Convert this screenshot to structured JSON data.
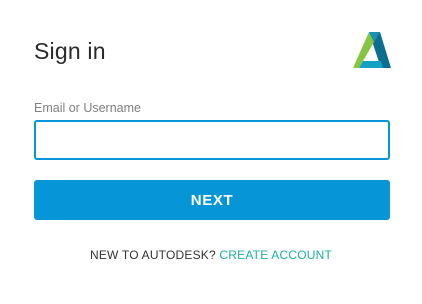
{
  "header": {
    "title": "Sign in",
    "logo_icon": "autodesk-logo-icon"
  },
  "form": {
    "email_label": "Email or Username",
    "email_value": "",
    "email_placeholder": "",
    "next_label": "NEXT"
  },
  "signup": {
    "prompt": "NEW TO AUTODESK?",
    "link_label": "CREATE ACCOUNT"
  },
  "colors": {
    "primary": "#0696d7",
    "link": "#1ab0a4",
    "text": "#2a2a2a",
    "label": "#808080",
    "logo_dark": "#0b6f8f",
    "logo_light": "#87c540"
  }
}
